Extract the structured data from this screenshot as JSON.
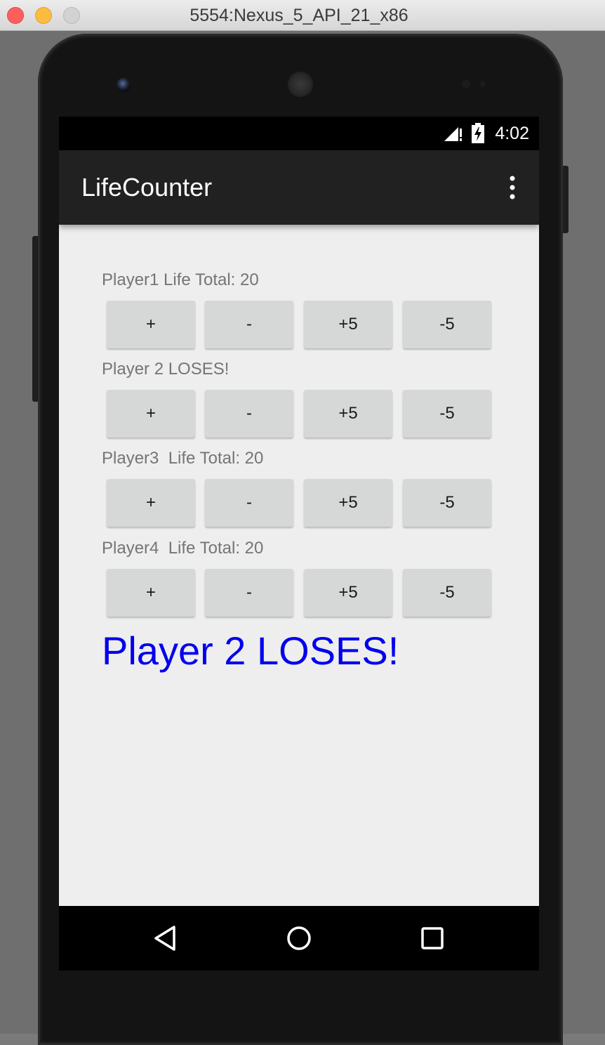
{
  "window": {
    "title": "5554:Nexus_5_API_21_x86"
  },
  "status_bar": {
    "time": "4:02",
    "icons": [
      "signal-icon",
      "battery-icon"
    ]
  },
  "app_bar": {
    "title": "LifeCounter",
    "menu_icon": "overflow-menu-icon"
  },
  "players": [
    {
      "label": "Player1 Life Total: 20",
      "buttons": [
        "+",
        "-",
        "+5",
        "-5"
      ]
    },
    {
      "label": "Player 2 LOSES!",
      "buttons": [
        "+",
        "-",
        "+5",
        "-5"
      ]
    },
    {
      "label": "Player3  Life Total: 20",
      "buttons": [
        "+",
        "-",
        "+5",
        "-5"
      ]
    },
    {
      "label": "Player4  Life Total: 20",
      "buttons": [
        "+",
        "-",
        "+5",
        "-5"
      ]
    }
  ],
  "loser_message": "Player 2 LOSES!",
  "nav_bar": {
    "buttons": [
      "back-icon",
      "home-icon",
      "recents-icon"
    ]
  },
  "colors": {
    "app_bar": "#212121",
    "status_bar": "#000000",
    "screen_bg": "#eeeeee",
    "button_bg": "#d6d7d7",
    "label_text": "#757575",
    "loser_text": "#0000ee"
  }
}
